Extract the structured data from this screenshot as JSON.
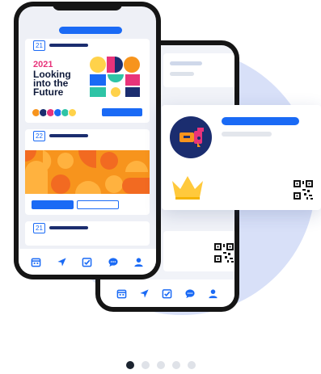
{
  "event_card": {
    "date_day_1": "21",
    "year": "2021",
    "headline": "Looking into the Future"
  },
  "second_card": {
    "date_day": "22"
  },
  "third_card": {
    "date_day": "21"
  },
  "bottom_nav": {
    "items": [
      {
        "icon": "calendar-icon"
      },
      {
        "icon": "navigate-icon"
      },
      {
        "icon": "checklist-icon"
      },
      {
        "icon": "chat-icon"
      },
      {
        "icon": "person-icon"
      }
    ]
  },
  "carousel": {
    "total": 5,
    "active_index": 0
  },
  "colors": {
    "accent": "#1a6af5",
    "navy": "#1b2d6f",
    "pink": "#e8337a",
    "orange": "#f7941d",
    "yellow": "#ffd24a",
    "background_circle": "#d8e0f8"
  }
}
